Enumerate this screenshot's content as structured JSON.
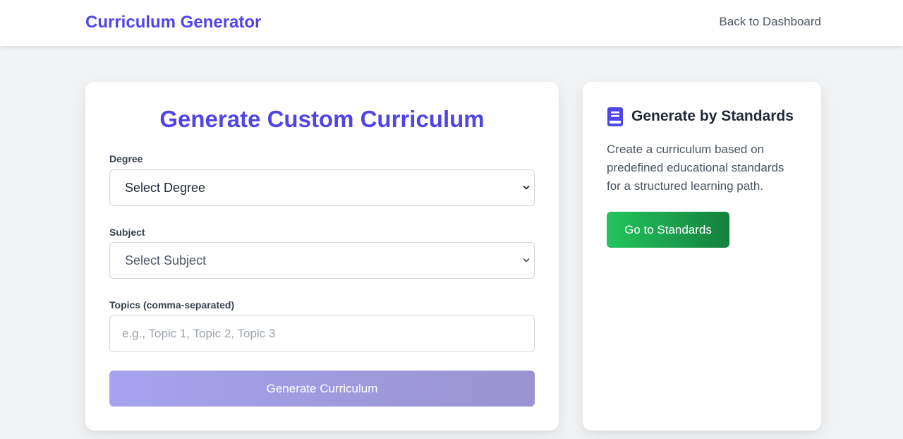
{
  "header": {
    "brand": "Curriculum Generator",
    "back_link": "Back to Dashboard"
  },
  "form": {
    "title": "Generate Custom Curriculum",
    "degree": {
      "label": "Degree",
      "value": "Select Degree"
    },
    "subject": {
      "label": "Subject",
      "value": "Select Subject"
    },
    "topics": {
      "label": "Topics (comma-separated)",
      "placeholder": "e.g., Topic 1, Topic 2, Topic 3",
      "value": ""
    },
    "submit_label": "Generate Curriculum"
  },
  "standards": {
    "icon": "book-icon",
    "title": "Generate by Standards",
    "description": "Create a curriculum based on predefined educational standards for a structured learning path.",
    "button_label": "Go to Standards"
  },
  "colors": {
    "brand": "#4f46e5",
    "primary_button_disabled": "#a5a3ee",
    "standards_button": "#22c55e",
    "background": "#f2f3f5"
  }
}
